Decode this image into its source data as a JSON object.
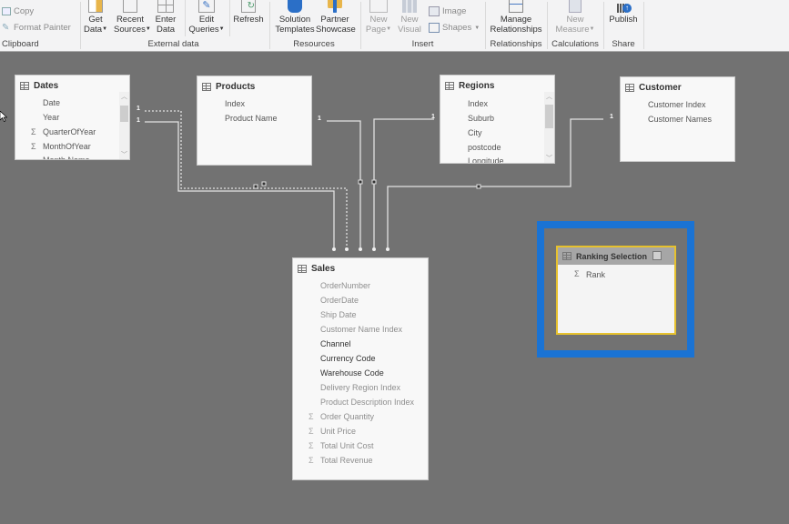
{
  "ribbon": {
    "clipboard": {
      "copy_label": "Copy",
      "format_painter_label": "Format Painter",
      "group_label": "Clipboard"
    },
    "external_data": {
      "get_data": [
        "Get",
        "Data"
      ],
      "recent_sources": [
        "Recent",
        "Sources"
      ],
      "enter_data": [
        "Enter",
        "Data"
      ],
      "edit_queries": [
        "Edit",
        "Queries"
      ],
      "refresh": "Refresh",
      "group_label": "External data"
    },
    "resources": {
      "solution_templates": [
        "Solution",
        "Templates"
      ],
      "partner_showcase": [
        "Partner",
        "Showcase"
      ],
      "group_label": "Resources"
    },
    "insert": {
      "new_page": [
        "New",
        "Page"
      ],
      "new_visual": [
        "New",
        "Visual"
      ],
      "image": "Image",
      "shapes": "Shapes",
      "group_label": "Insert"
    },
    "relationships": {
      "manage_relationships": [
        "Manage",
        "Relationships"
      ],
      "group_label": "Relationships"
    },
    "calculations": {
      "new_measure": [
        "New",
        "Measure"
      ],
      "group_label": "Calculations"
    },
    "share": {
      "publish": "Publish",
      "group_label": "Share"
    }
  },
  "tables": {
    "dates": {
      "title": "Dates",
      "fields": [
        "Date",
        "Year",
        "QuarterOfYear",
        "MonthOfYear",
        "Month Name"
      ]
    },
    "products": {
      "title": "Products",
      "fields": [
        "Index",
        "Product Name"
      ]
    },
    "regions": {
      "title": "Regions",
      "fields": [
        "Index",
        "Suburb",
        "City",
        "postcode",
        "Longitude"
      ]
    },
    "customer": {
      "title": "Customer",
      "fields": [
        "Customer Index",
        "Customer Names"
      ]
    },
    "sales": {
      "title": "Sales",
      "fields": [
        "OrderNumber",
        "OrderDate",
        "Ship Date",
        "Customer Name Index",
        "Channel",
        "Currency Code",
        "Warehouse Code",
        "Delivery Region Index",
        "Product Description Index",
        "Order Quantity",
        "Unit Price",
        "Total Unit Cost",
        "Total Revenue"
      ]
    },
    "ranking_selection": {
      "title": "Ranking Selection",
      "fields": [
        "Rank"
      ]
    }
  },
  "relationships": {
    "one_label": "1",
    "many_label": "*"
  },
  "colors": {
    "highlight": "#1a73d4",
    "selected_border": "#e6c12e",
    "canvas": "#727272"
  }
}
